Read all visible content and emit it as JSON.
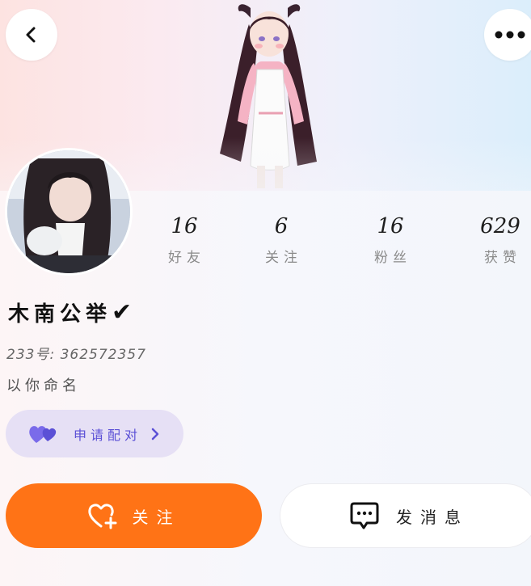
{
  "header": {
    "back_icon": "chevron-left-icon",
    "more_icon": "more-dots-icon"
  },
  "profile": {
    "nickname": "木南公举",
    "verified_mark": "✔",
    "uid_text": "233号: 362572357",
    "signature": "以你命名"
  },
  "stats": [
    {
      "value": "16",
      "label": "好友"
    },
    {
      "value": "6",
      "label": "关注"
    },
    {
      "value": "16",
      "label": "粉丝"
    },
    {
      "value": "629",
      "label": "获赞"
    }
  ],
  "pair": {
    "label": "申请配对",
    "icon": "hearts-icon"
  },
  "actions": {
    "follow_label": "关注",
    "follow_icon": "heart-plus-icon",
    "message_label": "发消息",
    "message_icon": "chat-bubble-icon"
  },
  "colors": {
    "accent_orange": "#ff7316",
    "pair_purple": "#5b50d6",
    "pair_bg": "#e6e0f5"
  }
}
